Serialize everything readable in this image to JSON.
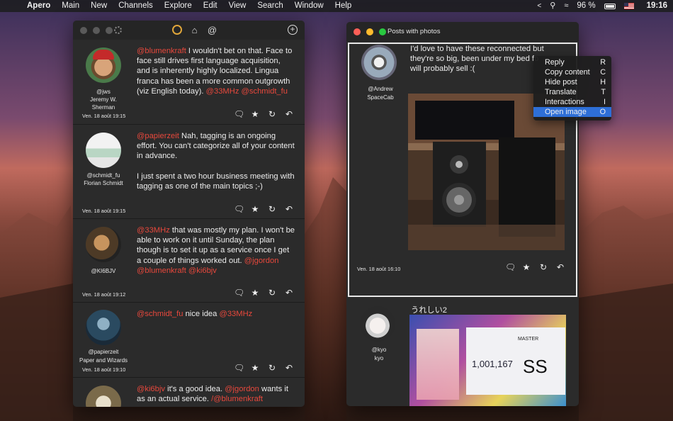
{
  "menubar": {
    "app": "Apero",
    "items": [
      "Main",
      "New",
      "Channels",
      "Explore",
      "Edit",
      "View",
      "Search",
      "Window",
      "Help"
    ],
    "battery": "96 %",
    "time": "19:16"
  },
  "left_window": {
    "posts": [
      {
        "handle": "@jws",
        "name": "Jeremy W. Sherman",
        "date": "Ven. 18 août 19:15",
        "segments": [
          {
            "t": "@blumenkraft",
            "m": true
          },
          {
            "t": " I wouldn't bet on that. Face to face still drives first language acquisition, and is inherently highly localized. Lingua franca has been a more common outgrowth (viz English today). ",
            "m": false
          },
          {
            "t": "@33MHz",
            "m": true
          },
          {
            "t": " ",
            "m": false
          },
          {
            "t": "@schmidt_fu",
            "m": true
          }
        ]
      },
      {
        "handle": "@schmidt_fu",
        "name": "Florian Schmidt",
        "date": "Ven. 18 août 19:15",
        "segments": [
          {
            "t": "@papierzeit",
            "m": true
          },
          {
            "t": " Nah, tagging is an ongoing effort. You can't categorize all of your content in advance.",
            "m": false
          }
        ],
        "paragraph2": "I just spent a two hour business meeting with tagging as one of the main topics ;-)"
      },
      {
        "handle": "@KI6BJV",
        "name": "",
        "date": "Ven. 18 août 19:12",
        "segments": [
          {
            "t": "@33MHz",
            "m": true
          },
          {
            "t": " that was mostly my plan.  I won't be able to work on it until Sunday, the plan though is to set it up as a service once I get a couple of things worked out.  ",
            "m": false
          },
          {
            "t": "@jgordon",
            "m": true
          },
          {
            "t": " ",
            "m": false
          },
          {
            "t": "@blumenkraft",
            "m": true
          },
          {
            "t": " ",
            "m": false
          },
          {
            "t": "@ki6bjv",
            "m": true
          }
        ]
      },
      {
        "handle": "@papierzeit",
        "name": "Paper and Wizards",
        "date": "Ven. 18 août 19:10",
        "segments": [
          {
            "t": "@schmidt_fu",
            "m": true
          },
          {
            "t": " nice idea ",
            "m": false
          },
          {
            "t": "@33MHz",
            "m": true
          }
        ]
      },
      {
        "handle": "",
        "name": "",
        "date": "",
        "segments": [
          {
            "t": "@ki6bjv",
            "m": true
          },
          {
            "t": " it's a good idea. ",
            "m": false
          },
          {
            "t": "@jgordon",
            "m": true
          },
          {
            "t": " wants it as an actual service. ",
            "m": false
          },
          {
            "t": "/@blumenkraft",
            "m": true
          }
        ]
      }
    ]
  },
  "right_window": {
    "title": "Posts with photos",
    "post1": {
      "handle": "@Andrew",
      "name": "SpaceCab",
      "date": "Ven. 18 août 16:10",
      "text": "I'd love to have these reconnected but they're so big, been under my bed fo will probably sell :("
    },
    "post2": {
      "handle": "@kyo",
      "name": "kyo",
      "text": "うれしい2",
      "photo_text": {
        "score": "1,001,167",
        "grade": "SS",
        "level": "MASTER"
      }
    }
  },
  "context_menu": {
    "items": [
      {
        "label": "Reply",
        "key": "R"
      },
      {
        "label": "Copy content",
        "key": "C"
      },
      {
        "label": "Hide post",
        "key": "H"
      },
      {
        "label": "Translate",
        "key": "T"
      },
      {
        "label": "Interactions",
        "key": "I"
      },
      {
        "label": "Open image",
        "key": "O"
      }
    ],
    "selected": "Open image"
  },
  "colors": {
    "mention": "#e8483c",
    "menu_highlight": "#2e6fd7",
    "window_bg": "#2b2b2b"
  }
}
